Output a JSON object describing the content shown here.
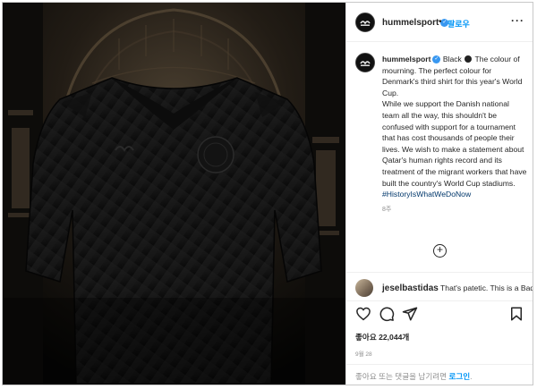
{
  "header": {
    "username": "hummelsport",
    "separator": "•",
    "follow_label": "팔로우",
    "more_label": "···"
  },
  "caption": {
    "username": "hummelsport",
    "first_word": "Black",
    "line1_rest": "The colour of mourning. The perfect colour for Denmark's third shirt for this year's World Cup.",
    "paragraph2": "While we support the Danish national team all the way, this shouldn't be confused with support for a tournament that has cost thousands of people their lives. We wish to make a statement about Qatar's human rights record and its treatment of the migrant workers that have built the country's World Cup stadiums.",
    "hashtag": "#HistoryIsWhatWeDoNow",
    "age": "8주"
  },
  "comment": {
    "username": "jeselbastidas",
    "text": "That's patetic. This is a Bad"
  },
  "engagement": {
    "likes": "좋아요 22,044개",
    "date": "9월 28"
  },
  "login_prompt": {
    "text": "좋아요 또는 댓글을 남기려면",
    "link": "로그인",
    "suffix": "."
  },
  "icons": {
    "like": "heart-icon",
    "comment": "comment-icon",
    "share": "send-icon",
    "save": "bookmark-icon",
    "load_more": "plus-circle-icon",
    "verified": "verified-badge-icon"
  },
  "colors": {
    "accent_blue": "#0095f6",
    "verified_blue": "#3897f0",
    "hashtag_blue": "#00376b",
    "muted_gray": "#8e8e8e"
  }
}
